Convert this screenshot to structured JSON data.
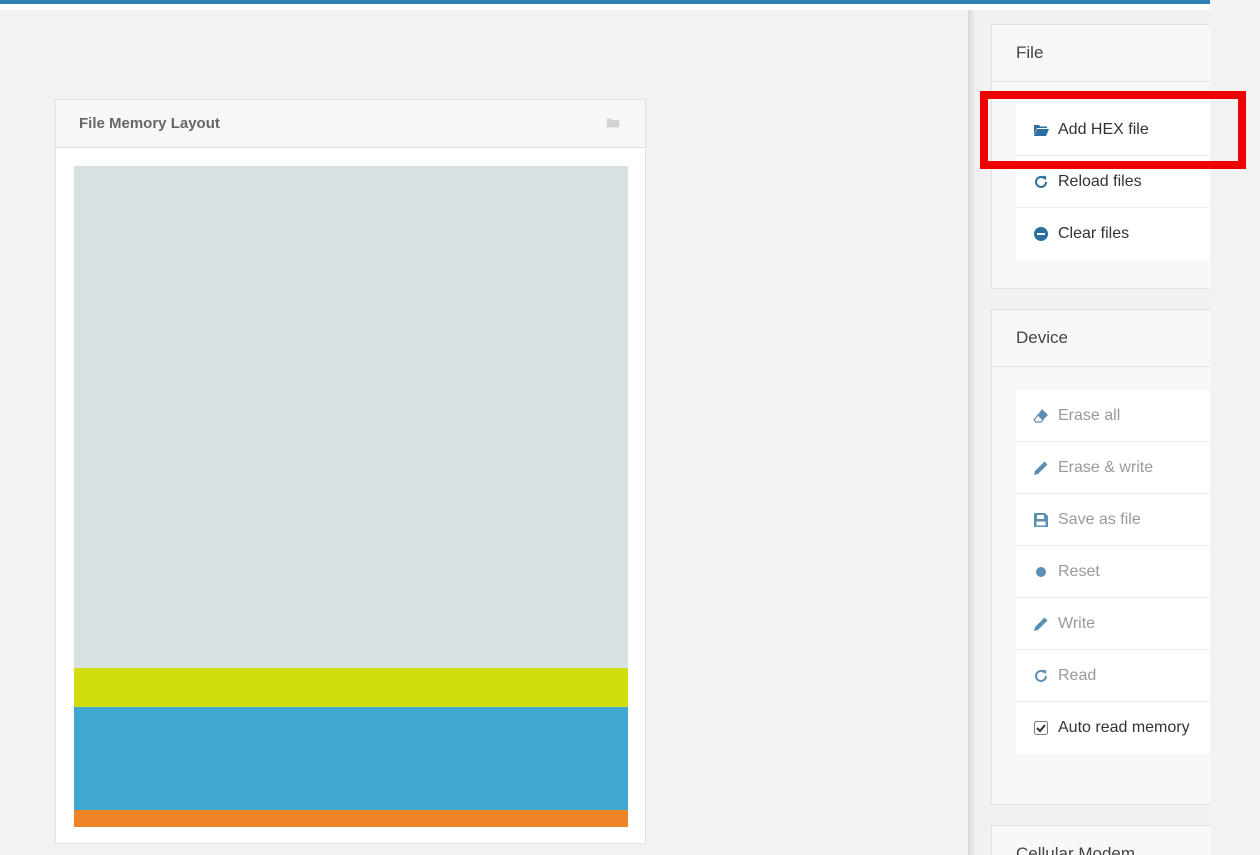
{
  "colors": {
    "accent": "#2f7fb4",
    "highlight": "#ee0000"
  },
  "memory_layout": {
    "title": "File Memory Layout",
    "icon": "folder-icon",
    "regions": [
      {
        "name": "empty",
        "color": "#d9e0e2",
        "fraction": 0.759
      },
      {
        "name": "region-2",
        "color": "#d0de10",
        "fraction": 0.059
      },
      {
        "name": "region-3",
        "color": "#40a8ce",
        "fraction": 0.156
      },
      {
        "name": "region-4",
        "color": "#ee8425",
        "fraction": 0.026
      }
    ]
  },
  "file_panel": {
    "title": "File",
    "items": [
      {
        "label": "Add HEX file",
        "icon": "folder-open-icon"
      },
      {
        "label": "Reload files",
        "icon": "refresh-icon"
      },
      {
        "label": "Clear files",
        "icon": "minus-circle-icon"
      }
    ]
  },
  "device_panel": {
    "title": "Device",
    "items": [
      {
        "label": "Erase all",
        "icon": "eraser-icon"
      },
      {
        "label": "Erase & write",
        "icon": "pencil-icon"
      },
      {
        "label": "Save as file",
        "icon": "save-icon"
      },
      {
        "label": "Reset",
        "icon": "dot-icon"
      },
      {
        "label": "Write",
        "icon": "pencil-icon"
      },
      {
        "label": "Read",
        "icon": "refresh-icon"
      },
      {
        "label": "Auto read memory",
        "icon": "checkbox-icon",
        "checked": true
      }
    ]
  },
  "modem_panel": {
    "title": "Cellular Modem"
  }
}
